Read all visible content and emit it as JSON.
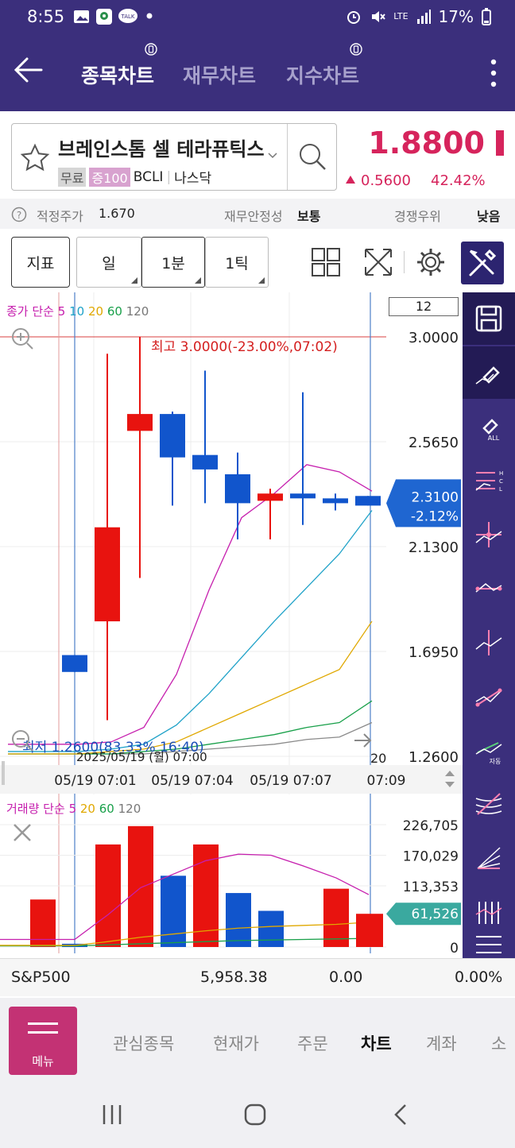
{
  "status": {
    "time": "8:55",
    "lte": "LTE",
    "battery": "17%"
  },
  "header": {
    "tabs": [
      {
        "label": "종목차트",
        "active": true
      },
      {
        "label": "재무차트",
        "active": false
      },
      {
        "label": "지수차트",
        "active": false
      }
    ]
  },
  "stock": {
    "name": "브레인스톰 셀 테라퓨틱스",
    "tags": [
      "무료",
      "증100",
      "BCLI",
      "나스닥"
    ],
    "price": "1.8800",
    "change": "0.5600",
    "change_pct": "42.42%"
  },
  "inforow": {
    "fair_label": "적정주가",
    "fair_value": "1.670",
    "fin_label": "재무안정성",
    "fin_value": "보통",
    "comp_label": "경쟁우위",
    "comp_value": "낮음"
  },
  "toolbar": {
    "indicator": "지표",
    "day": "일",
    "min": "1분",
    "tick": "1틱"
  },
  "chart_data": {
    "type": "candlestick",
    "legend_price": {
      "label": "종가 단순",
      "periods": [
        "5",
        "10",
        "20",
        "60",
        "120"
      ],
      "colors": [
        "#c61fae",
        "#1fa2c8",
        "#e0a800",
        "#19a04a",
        "#777777"
      ]
    },
    "legend_volume": {
      "label": "거래량 단순",
      "periods": [
        "5",
        "20",
        "60",
        "120"
      ],
      "colors": [
        "#c61fae",
        "#e0a800",
        "#19a04a",
        "#777777"
      ]
    },
    "period_box": "12",
    "yticks": [
      "3.0000",
      "2.5650",
      "2.1300",
      "1.6950",
      "1.2600"
    ],
    "ylim": [
      1.26,
      3.0
    ],
    "current_price": "2.3100",
    "current_pct": "-2.12%",
    "high_note": "최고 3.0000(-23.00%,07:02)",
    "low_note": "최저 1.2600(83.33% 16:40)",
    "date_note": "2025/05/19 (월) 07:00",
    "right_edge_label": "20",
    "xticks": [
      "05/19 07:01",
      "05/19 07:04",
      "05/19 07:07",
      "07:09"
    ],
    "candles": [
      {
        "o": 1.68,
        "h": 1.68,
        "l": 1.61,
        "c": 1.61
      },
      {
        "o": 1.82,
        "h": 2.93,
        "l": 1.41,
        "c": 2.21
      },
      {
        "o": 2.61,
        "h": 3.0,
        "l": 2.0,
        "c": 2.68
      },
      {
        "o": 2.68,
        "h": 2.69,
        "l": 2.3,
        "c": 2.5
      },
      {
        "o": 2.51,
        "h": 2.86,
        "l": 2.31,
        "c": 2.45
      },
      {
        "o": 2.43,
        "h": 2.52,
        "l": 2.16,
        "c": 2.31
      },
      {
        "o": 2.32,
        "h": 2.37,
        "l": 2.16,
        "c": 2.35
      },
      {
        "o": 2.35,
        "h": 2.77,
        "l": 2.22,
        "c": 2.33
      },
      {
        "o": 2.33,
        "h": 2.35,
        "l": 2.28,
        "c": 2.31
      },
      {
        "o": 2.34,
        "h": 2.34,
        "l": 2.3,
        "c": 2.3
      }
    ],
    "ma5": [
      1.31,
      1.31,
      1.32,
      1.38,
      1.6,
      1.95,
      2.25,
      2.35,
      2.47,
      2.44,
      2.36
    ],
    "ma10": [
      1.28,
      1.28,
      1.29,
      1.31,
      1.39,
      1.52,
      1.67,
      1.82,
      1.96,
      2.1,
      2.28
    ],
    "ma20": [
      1.27,
      1.27,
      1.28,
      1.29,
      1.32,
      1.38,
      1.44,
      1.5,
      1.56,
      1.62,
      1.82
    ],
    "ma60": [
      1.27,
      1.27,
      1.27,
      1.28,
      1.29,
      1.31,
      1.33,
      1.35,
      1.38,
      1.4,
      1.49
    ],
    "ma120": [
      1.27,
      1.27,
      1.27,
      1.27,
      1.28,
      1.29,
      1.3,
      1.31,
      1.33,
      1.34,
      1.4
    ],
    "volume_yticks": [
      "226,705",
      "170,029",
      "113,353",
      "0"
    ],
    "volume_ylim": [
      0,
      226705
    ],
    "volume_current": "61,526",
    "volumes": [
      88000,
      6000,
      190000,
      224000,
      132000,
      190000,
      100000,
      67000,
      0,
      108000,
      60000,
      61526
    ],
    "volume_up": [
      true,
      false,
      true,
      true,
      false,
      true,
      false,
      false,
      null,
      true,
      false,
      true
    ],
    "vma5": [
      14000,
      14000,
      60000,
      110000,
      135000,
      160000,
      172000,
      170000,
      150000,
      128000,
      97000
    ],
    "vma20": [
      3000,
      3000,
      10000,
      18000,
      24000,
      30000,
      35000,
      38000,
      40000,
      42000,
      46000
    ],
    "vma60": [
      2000,
      2000,
      4000,
      6000,
      8000,
      10000,
      12000,
      13000,
      14000,
      15000,
      16000
    ]
  },
  "spx": {
    "name": "S&P500",
    "value": "5,958.38",
    "change": "0.00",
    "pct": "0.00%"
  },
  "bottomnav": {
    "menu": "메뉴",
    "items": [
      "관심종목",
      "현재가",
      "주문",
      "차트",
      "계좌",
      "소"
    ],
    "active": "차트"
  }
}
